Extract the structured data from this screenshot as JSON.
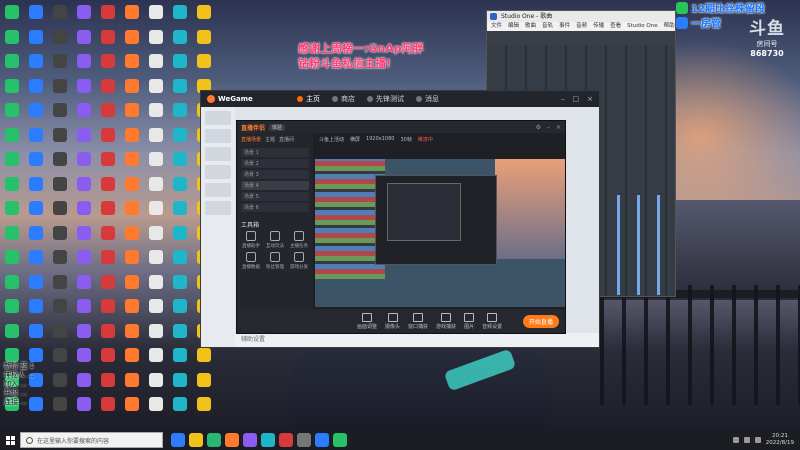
{
  "overlay": {
    "line1": "感谢上周榜一:GnAp阿胖",
    "line2": "钻粉斗鱼私信主播!"
  },
  "live_badge": {
    "line1": "12期比丝株留段",
    "line2": "一房管"
  },
  "room": {
    "logo": "斗鱼",
    "label": "房间号",
    "number": "868730"
  },
  "daw": {
    "title": "Studio One - 歌曲",
    "menu": [
      "文件",
      "编辑",
      "歌曲",
      "音轨",
      "事件",
      "音频",
      "传输",
      "查看",
      "Studio One",
      "帮助"
    ]
  },
  "wegame": {
    "logo": "WeGame",
    "tabs": [
      {
        "label": "主页",
        "active": true
      },
      {
        "label": "商店",
        "active": false
      },
      {
        "label": "先锋测试",
        "active": false
      },
      {
        "label": "消息",
        "active": false
      }
    ],
    "bottom_text": "辅助设置"
  },
  "stream": {
    "logo": "直播伴侣",
    "badge": "体验",
    "tabs": [
      "直播场景",
      "主题",
      "直播间"
    ],
    "scenes": [
      "场景 1",
      "场景 2",
      "场景 3",
      "场景 4",
      "场景 5",
      "场景 6"
    ],
    "tools_label": "工具箱",
    "tools": [
      "直播助手",
      "互动玩法",
      "主播任务",
      "直播数据",
      "粉丝管理",
      "游戏分发"
    ],
    "header_items": [
      "斗鱼上活动",
      "横屏",
      "1920x1080",
      "30帧",
      "推流中"
    ],
    "bottom_buttons": [
      "画面调整",
      "摄像头",
      "窗口捕获",
      "游戏捕获",
      "图片",
      "音频设置"
    ],
    "go_live": "开始直播"
  },
  "comments": [
    "新增 蓝 1",
    "神秘人 ...",
    "加入 ...",
    "升级 ...",
    "连接 ..."
  ],
  "taskbar": {
    "search_placeholder": "在这里输入你要搜索的内容",
    "time": "20:21",
    "date": "2022/8/19"
  }
}
